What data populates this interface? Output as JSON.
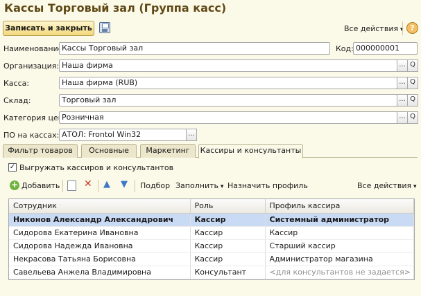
{
  "window": {
    "title": "Кассы Торговый зал (Группа касс)"
  },
  "toolbar": {
    "save_close": "Записать и закрыть",
    "all_actions": "Все действия",
    "help": "?"
  },
  "form": {
    "name_label": "Наименование:",
    "name_value": "Кассы Торговый зал",
    "code_label": "Код:",
    "code_value": "000000001",
    "org_label": "Организация:",
    "org_value": "Наша фирма",
    "cash_label": "Касса:",
    "cash_value": "Наша фирма (RUB)",
    "warehouse_label": "Склад:",
    "warehouse_value": "Торговый зал",
    "price_label": "Категория цен:",
    "price_value": "Розничная",
    "po_label": "ПО на кассах:",
    "po_value": "АТОЛ: Frontol Win32",
    "ellipsis": "...",
    "search": "Q"
  },
  "tabs": [
    "Фильтр товаров",
    "Основные",
    "Маркетинг",
    "Кассиры и консультанты"
  ],
  "tab_panel": {
    "checkbox_label": "Выгружать кассиров и консультантов",
    "checkbox_mark": "✓",
    "add": "Добавить",
    "selection": "Подбор",
    "fill": "Заполнить",
    "assign_profile": "Назначить профиль",
    "all_actions": "Все действия"
  },
  "grid": {
    "headers": [
      "Сотрудник",
      "Роль",
      "Профиль кассира"
    ],
    "rows": [
      [
        "Никонов Александр Александрович",
        "Кассир",
        "Системный администратор"
      ],
      [
        "Сидорова Екатерина Ивановна",
        "Кассир",
        "Кассир"
      ],
      [
        "Сидорова Надежда Ивановна",
        "Кассир",
        "Старший кассир"
      ],
      [
        "Некрасова Татьяна Борисовна",
        "Кассир",
        "Администратор магазина"
      ],
      [
        "Савельева Анжела Владимировна",
        "Консультант",
        "<для консультантов не задается>"
      ]
    ]
  }
}
